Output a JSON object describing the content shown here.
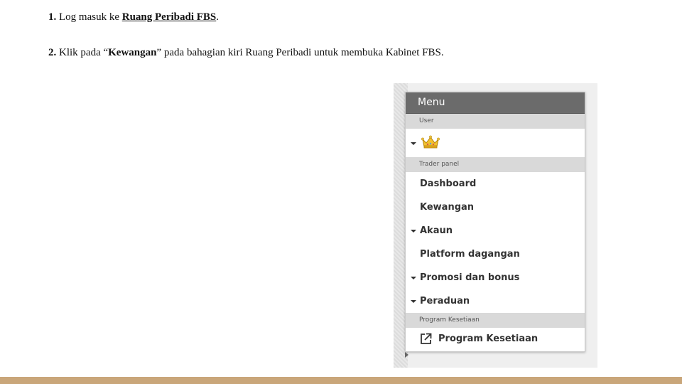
{
  "steps": [
    {
      "number": "1.",
      "text_before": " Log masuk ke ",
      "link": "Ruang Peribadi FBS",
      "text_after": "."
    },
    {
      "number": "2.",
      "text_before": " Klik pada “",
      "emphasis": "Kewangan",
      "text_after": "” pada bahagian kiri Ruang Peribadi untuk membuka Kabinet FBS."
    }
  ],
  "menu": {
    "title": "Menu",
    "user_section_label": "User",
    "user_icon": "crown-icon",
    "trader_section_label": "Trader panel",
    "items": [
      {
        "label": "Dashboard",
        "expandable": false
      },
      {
        "label": "Kewangan",
        "expandable": false
      },
      {
        "label": "Akaun",
        "expandable": true
      },
      {
        "label": "Platform dagangan",
        "expandable": false
      },
      {
        "label": "Promosi dan bonus",
        "expandable": true
      },
      {
        "label": "Peraduan",
        "expandable": true
      }
    ],
    "loyalty_section_label": "Program Kesetiaan",
    "loyalty_item": {
      "label": "Program Kesetiaan",
      "icon": "external-link-icon"
    }
  },
  "colors": {
    "menu_header": "#6b6b6b",
    "section_label_bg": "#d9d9d9",
    "bottom_bar": "#c9a67a"
  }
}
